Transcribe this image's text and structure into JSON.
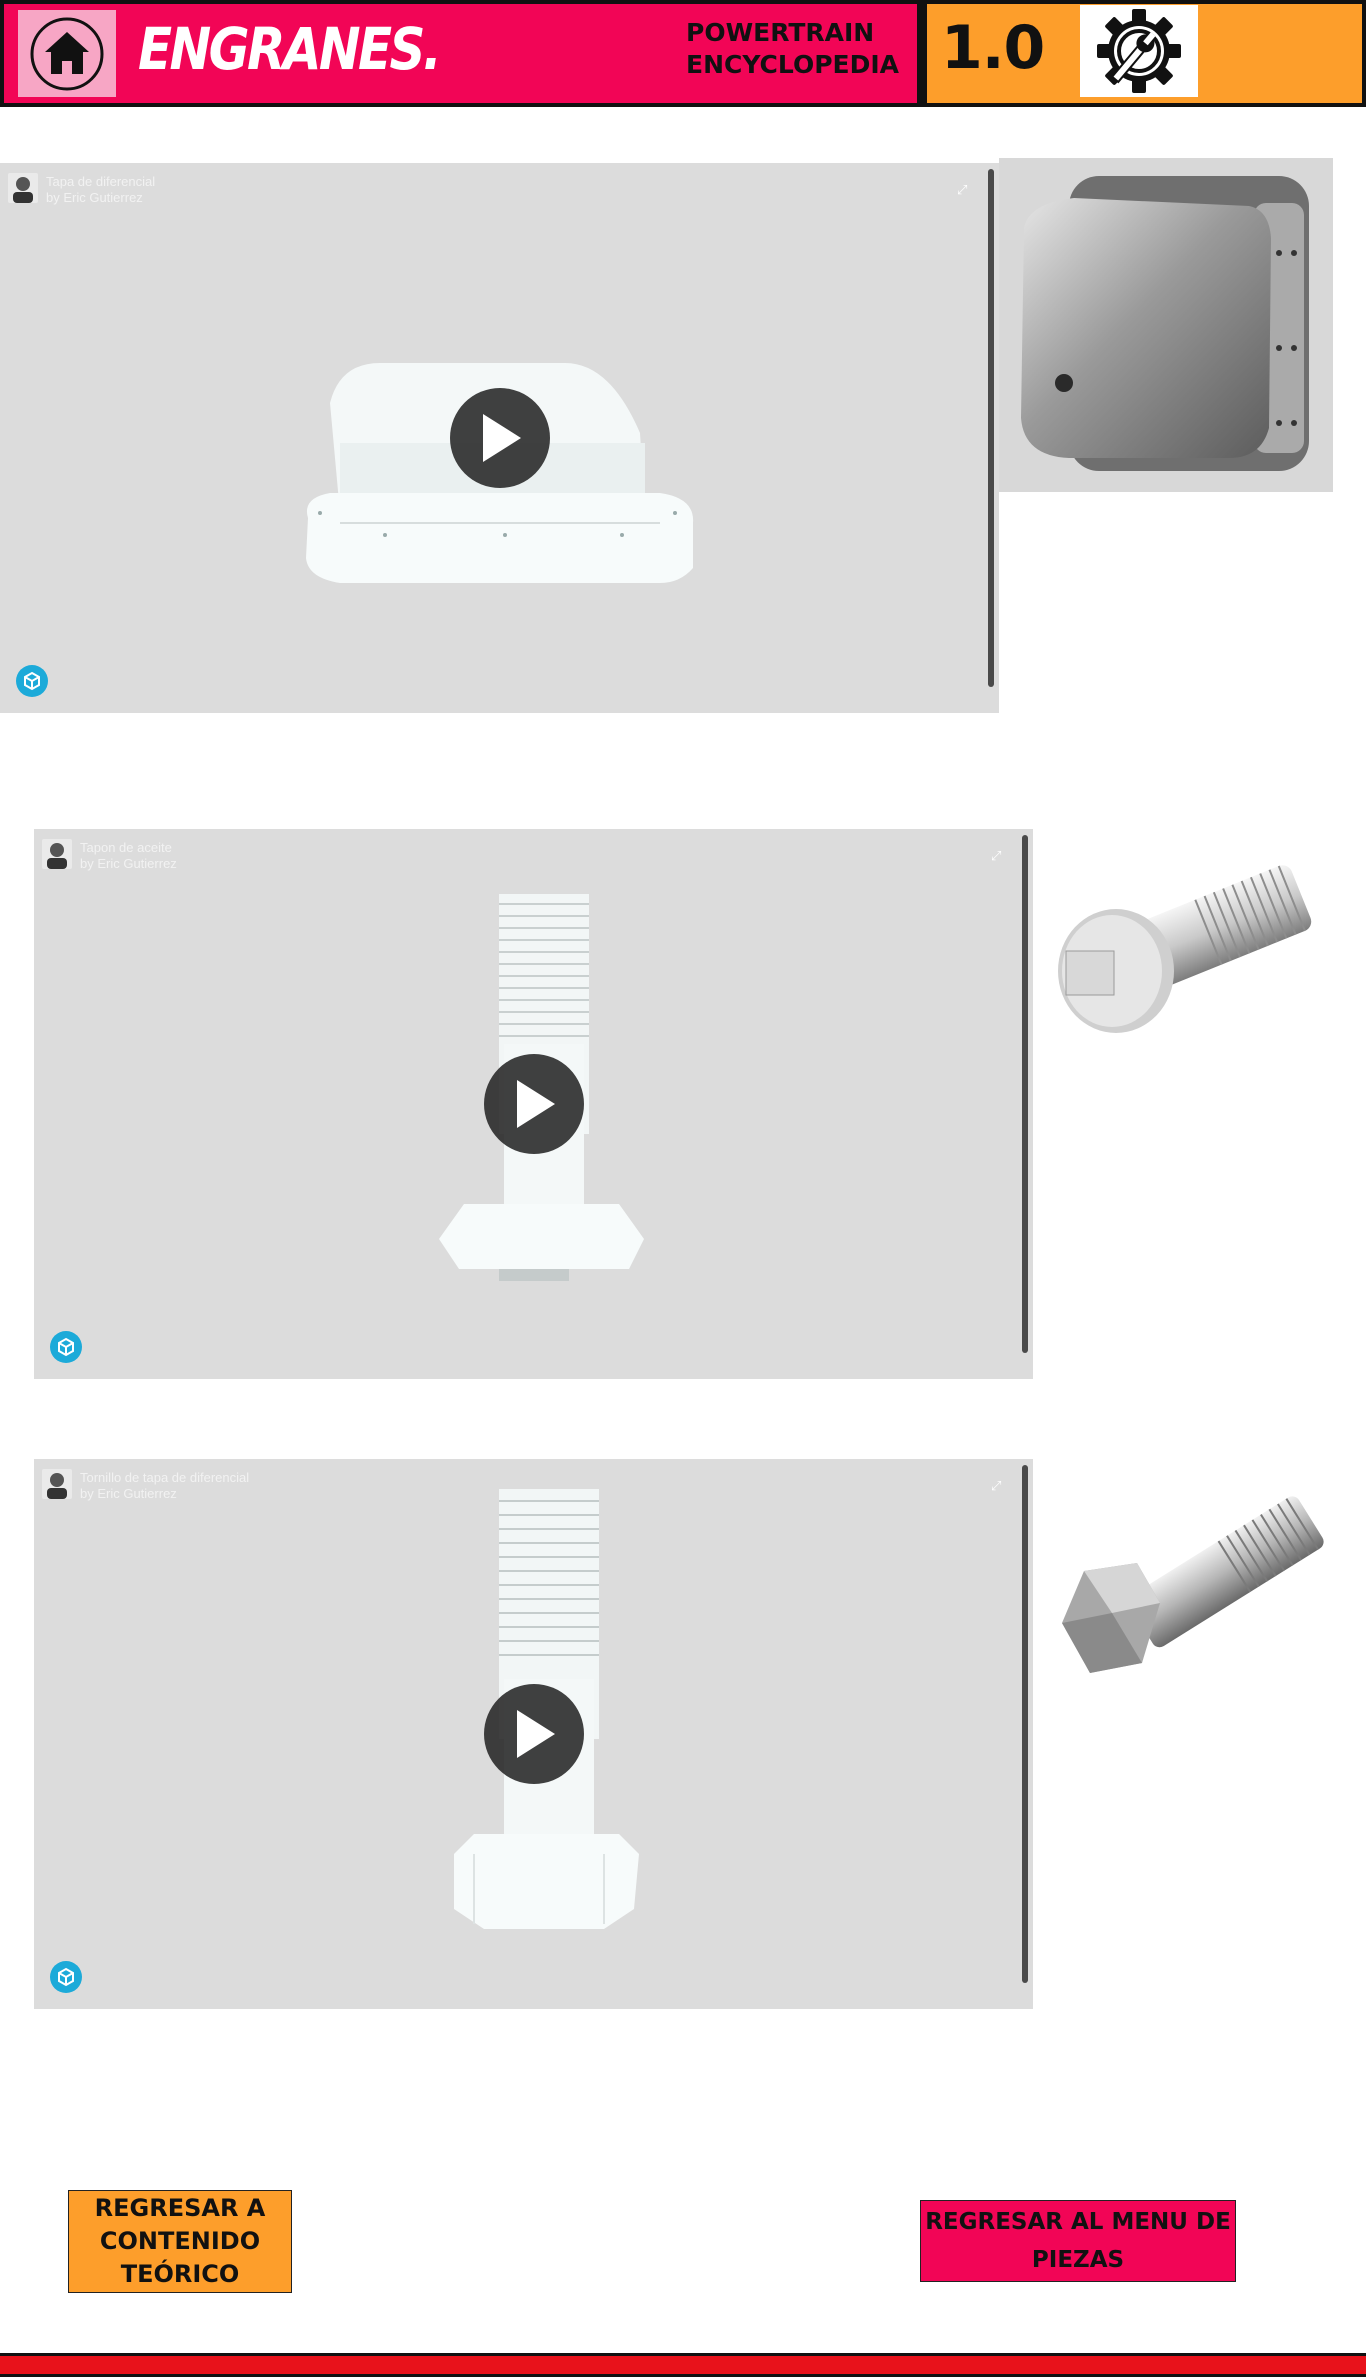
{
  "header": {
    "home_icon": "house-icon",
    "brand": "ENGRANES.",
    "tagline_line1": "POWERTRAIN",
    "tagline_line2": "ENCYCLOPEDIA",
    "version": "1.0",
    "logo_icon": "gear-wrench-icon"
  },
  "viewers": [
    {
      "title": "Tapa de diferencial",
      "author": "by Eric Gutierrez"
    },
    {
      "title": "Tapon de aceite",
      "author": "by Eric Gutierrez"
    },
    {
      "title": "Tornillo de tapa de diferencial",
      "author": "by Eric Gutierrez"
    }
  ],
  "buttons": {
    "back_theory": "REGRESAR A CONTENIDO TEÓRICO",
    "back_menu": "REGRESAR AL MENU DE PIEZAS"
  },
  "colors": {
    "pink": "#f20556",
    "orange": "#fd9e2b",
    "viewer_bg": "#dcdcdc",
    "footer_red": "#e8121b"
  }
}
